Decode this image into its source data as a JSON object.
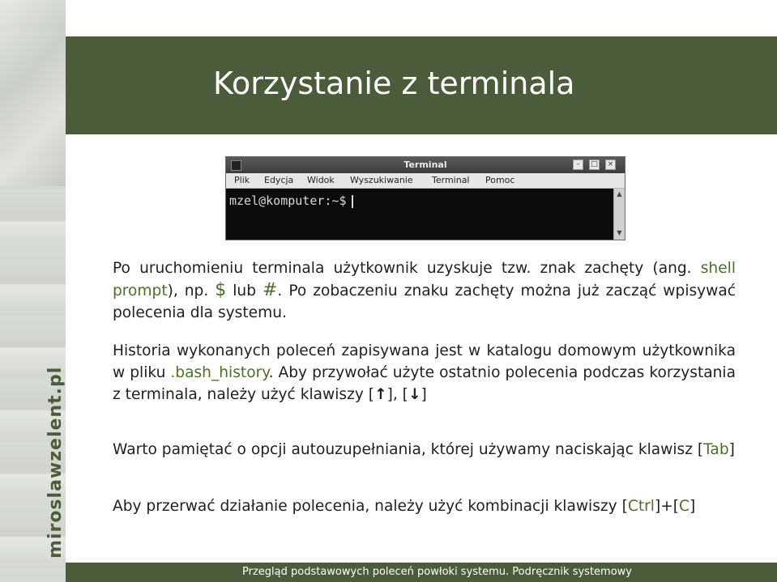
{
  "slide": {
    "title": "Korzystanie z terminala",
    "footer": "Przegląd podstawowych poleceń powłoki systemu. Podręcznik systemowy",
    "watermark": "miroslawzelent.pl"
  },
  "terminal": {
    "window_title": "Terminal",
    "menu": [
      "Plik",
      "Edycja",
      "Widok",
      "Wyszukiwanie",
      "Terminal",
      "Pomoc"
    ],
    "prompt": "mzel@komputer:~$"
  },
  "p1": {
    "a": "Po uruchomieniu terminala użytkownik uzyskuje tzw. znak zachęty (ang. ",
    "shell": "shell prompt",
    "b": "), np. ",
    "dollar": "$",
    "c": " lub ",
    "hash": "#",
    "d": ". Po zobaczeniu znaku zachęty można już zacząć wpisywać polecenia dla systemu."
  },
  "p2": {
    "a": "Historia wykonanych poleceń zapisywana jest w katalogu domowym użytkownika w pliku ",
    "file": ".bash_history",
    "b": ". Aby przywołać użyte ostatnio polecenia podczas korzystania z terminala, należy użyć klawiszy [",
    "up": "↑",
    "c": "], [",
    "down": "↓",
    "d": "]"
  },
  "p3": {
    "a": "Warto pamiętać o opcji autouzupełniania, której używamy naciskając klawisz [",
    "key": "Tab",
    "b": "]"
  },
  "p4": {
    "a": "Aby przerwać działanie polecenia, należy użyć kombinacji klawiszy [",
    "key1": "Ctrl",
    "b": "]+[",
    "key2": "C",
    "c": "]"
  },
  "colors": {
    "header": "#4b5c3a",
    "highlight": "#4b6f2a"
  }
}
